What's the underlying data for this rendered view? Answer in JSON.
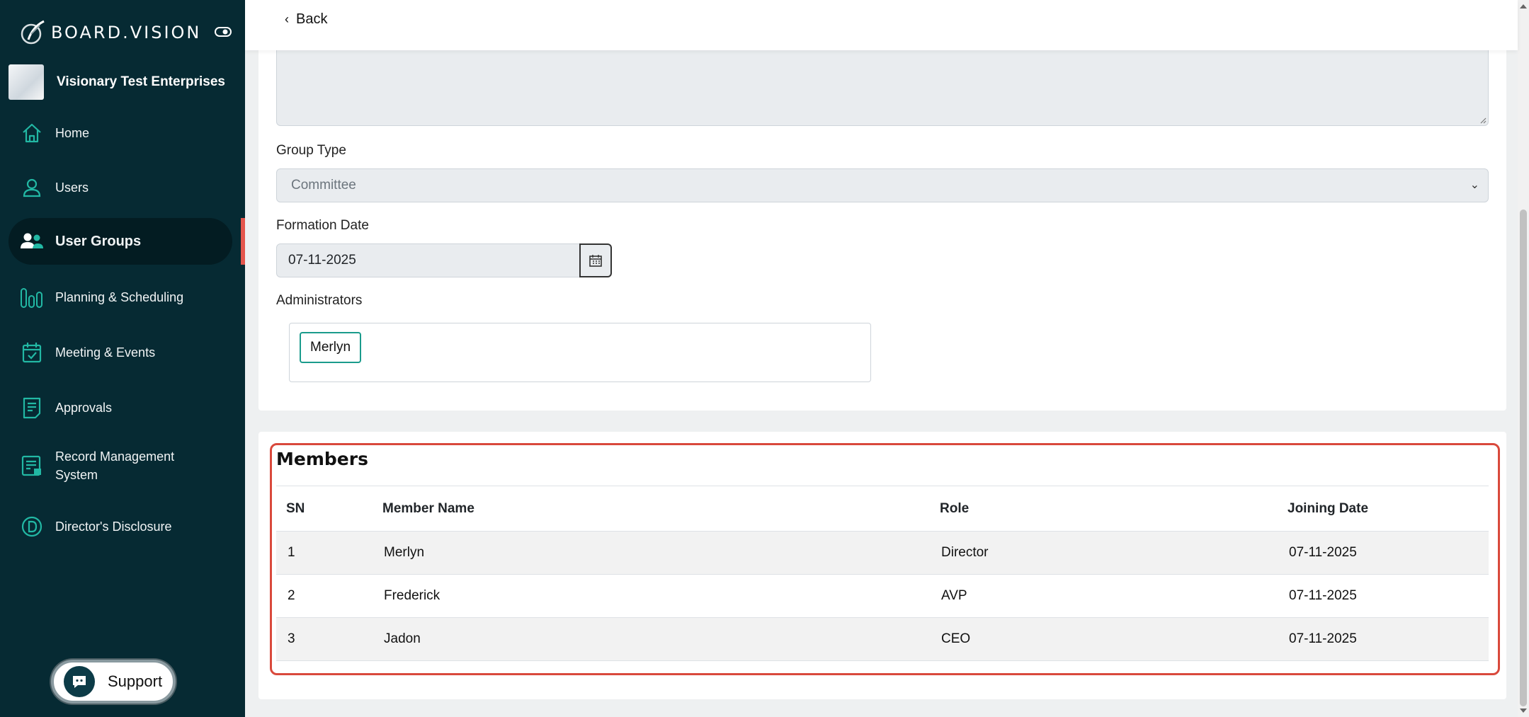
{
  "brand": {
    "name": "BOARD.VISION"
  },
  "organization": {
    "name": "Visionary Test Enterprises"
  },
  "sidebar": {
    "items": [
      {
        "label": "Home",
        "icon": "home-icon"
      },
      {
        "label": "Users",
        "icon": "user-icon"
      },
      {
        "label": "User Groups",
        "icon": "user-group-icon",
        "active": true
      },
      {
        "label": "Planning & Scheduling",
        "icon": "bar-chart-icon"
      },
      {
        "label": "Meeting & Events",
        "icon": "calendar-check-icon"
      },
      {
        "label": "Approvals",
        "icon": "document-list-icon"
      },
      {
        "label": "Record Management System",
        "icon": "record-icon"
      },
      {
        "label": "Director's Disclosure",
        "icon": "circle-d-icon"
      }
    ]
  },
  "support": {
    "label": "Support"
  },
  "topbar": {
    "back_label": "Back"
  },
  "form": {
    "group_type_label": "Group Type",
    "group_type_value": "Committee",
    "formation_date_label": "Formation Date",
    "formation_date_value": "07-11-2025",
    "administrators_label": "Administrators",
    "administrators": [
      "Merlyn"
    ]
  },
  "members": {
    "title": "Members",
    "columns": [
      "SN",
      "Member Name",
      "Role",
      "Joining Date"
    ],
    "rows": [
      [
        "1",
        "Merlyn",
        "Director",
        "07-11-2025"
      ],
      [
        "2",
        "Frederick",
        "AVP",
        "07-11-2025"
      ],
      [
        "3",
        "Jadon",
        "CEO",
        "07-11-2025"
      ]
    ]
  },
  "colors": {
    "sidebar_bg": "#062a33",
    "accent_teal": "#1a9b8c",
    "highlight_red": "#d9493c"
  }
}
